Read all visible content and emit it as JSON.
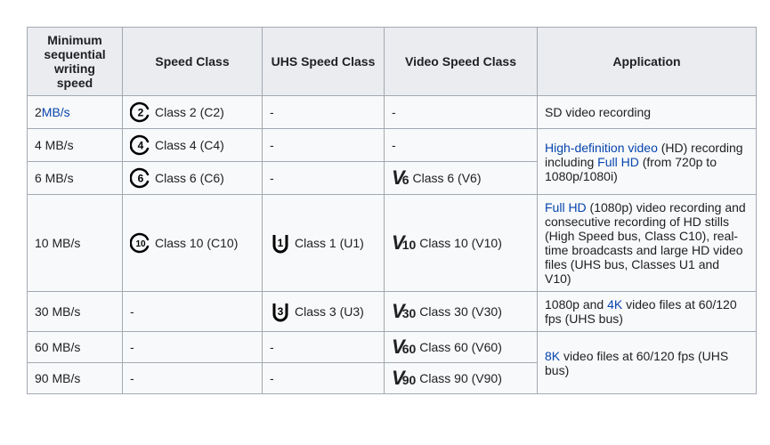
{
  "headers": {
    "min_speed": "Minimum sequential writing speed",
    "speed_class": "Speed Class",
    "uhs_speed_class": "UHS Speed Class",
    "video_speed_class": "Video Speed Class",
    "application": "Application"
  },
  "units_link": "MB/s",
  "dash": "-",
  "rows": {
    "r2": {
      "speed_num": "2",
      "speed_unit": " MB/s",
      "c_num": "2",
      "c_label": "Class 2 (C2)"
    },
    "r4": {
      "speed_num": "4",
      "speed_unit": " MB/s",
      "c_num": "4",
      "c_label": "Class 4 (C4)"
    },
    "r6": {
      "speed_num": "6",
      "speed_unit": " MB/s",
      "c_num": "6",
      "c_label": "Class 6 (C6)",
      "v_num": "6",
      "v_label": "Class 6 (V6)"
    },
    "r10": {
      "speed_num": "10",
      "speed_unit": " MB/s",
      "c_num": "10",
      "c_label": "Class 10 (C10)",
      "u_num": "1",
      "u_label": "Class 1 (U1)",
      "v_num": "10",
      "v_label": "Class 10 (V10)"
    },
    "r30": {
      "speed_num": "30",
      "speed_unit": " MB/s",
      "u_num": "3",
      "u_label": "Class 3 (U3)",
      "v_num": "30",
      "v_label": "Class 30 (V30)"
    },
    "r60": {
      "speed_num": "60",
      "speed_unit": " MB/s",
      "v_num": "60",
      "v_label": "Class 60 (V60)"
    },
    "r90": {
      "speed_num": "90",
      "speed_unit": " MB/s",
      "v_num": "90",
      "v_label": "Class 90 (V90)"
    }
  },
  "apps": {
    "sd": "SD video recording",
    "hd_link": "High-definition video",
    "hd_text": " (HD) recording including ",
    "fullhd_link": "Full HD",
    "hd_tail": " (from 720p to 1080p/1080i)",
    "fullhd2_link": "Full HD",
    "c10_text": " (1080p) video recording and consecutive recording of HD stills (High Speed bus, Class C10), real-time broadcasts and large HD video files (UHS bus, Classes U1 and V10)",
    "v30_pre": "1080p and ",
    "v30_link": "4K",
    "v30_post": " video files at 60/120 fps (UHS bus)",
    "v60_link": "8K",
    "v60_post": " video files at 60/120 fps (UHS bus)"
  },
  "chart_data": {
    "type": "table",
    "title": "SD card speed classes and applications",
    "columns": [
      "Minimum sequential writing speed",
      "Speed Class",
      "UHS Speed Class",
      "Video Speed Class",
      "Application"
    ],
    "rows": [
      [
        "2 MB/s",
        "Class 2 (C2)",
        "-",
        "-",
        "SD video recording"
      ],
      [
        "4 MB/s",
        "Class 4 (C4)",
        "-",
        "-",
        "High-definition video (HD) recording including Full HD (from 720p to 1080p/1080i)"
      ],
      [
        "6 MB/s",
        "Class 6 (C6)",
        "-",
        "Class 6 (V6)",
        "High-definition video (HD) recording including Full HD (from 720p to 1080p/1080i)"
      ],
      [
        "10 MB/s",
        "Class 10 (C10)",
        "Class 1 (U1)",
        "Class 10 (V10)",
        "Full HD (1080p) video recording and consecutive recording of HD stills (High Speed bus, Class C10), real-time broadcasts and large HD video files (UHS bus, Classes U1 and V10)"
      ],
      [
        "30 MB/s",
        "-",
        "Class 3 (U3)",
        "Class 30 (V30)",
        "1080p and 4K video files at 60/120 fps (UHS bus)"
      ],
      [
        "60 MB/s",
        "-",
        "-",
        "Class 60 (V60)",
        "8K video files at 60/120 fps (UHS bus)"
      ],
      [
        "90 MB/s",
        "-",
        "-",
        "Class 90 (V90)",
        "8K video files at 60/120 fps (UHS bus)"
      ]
    ]
  }
}
